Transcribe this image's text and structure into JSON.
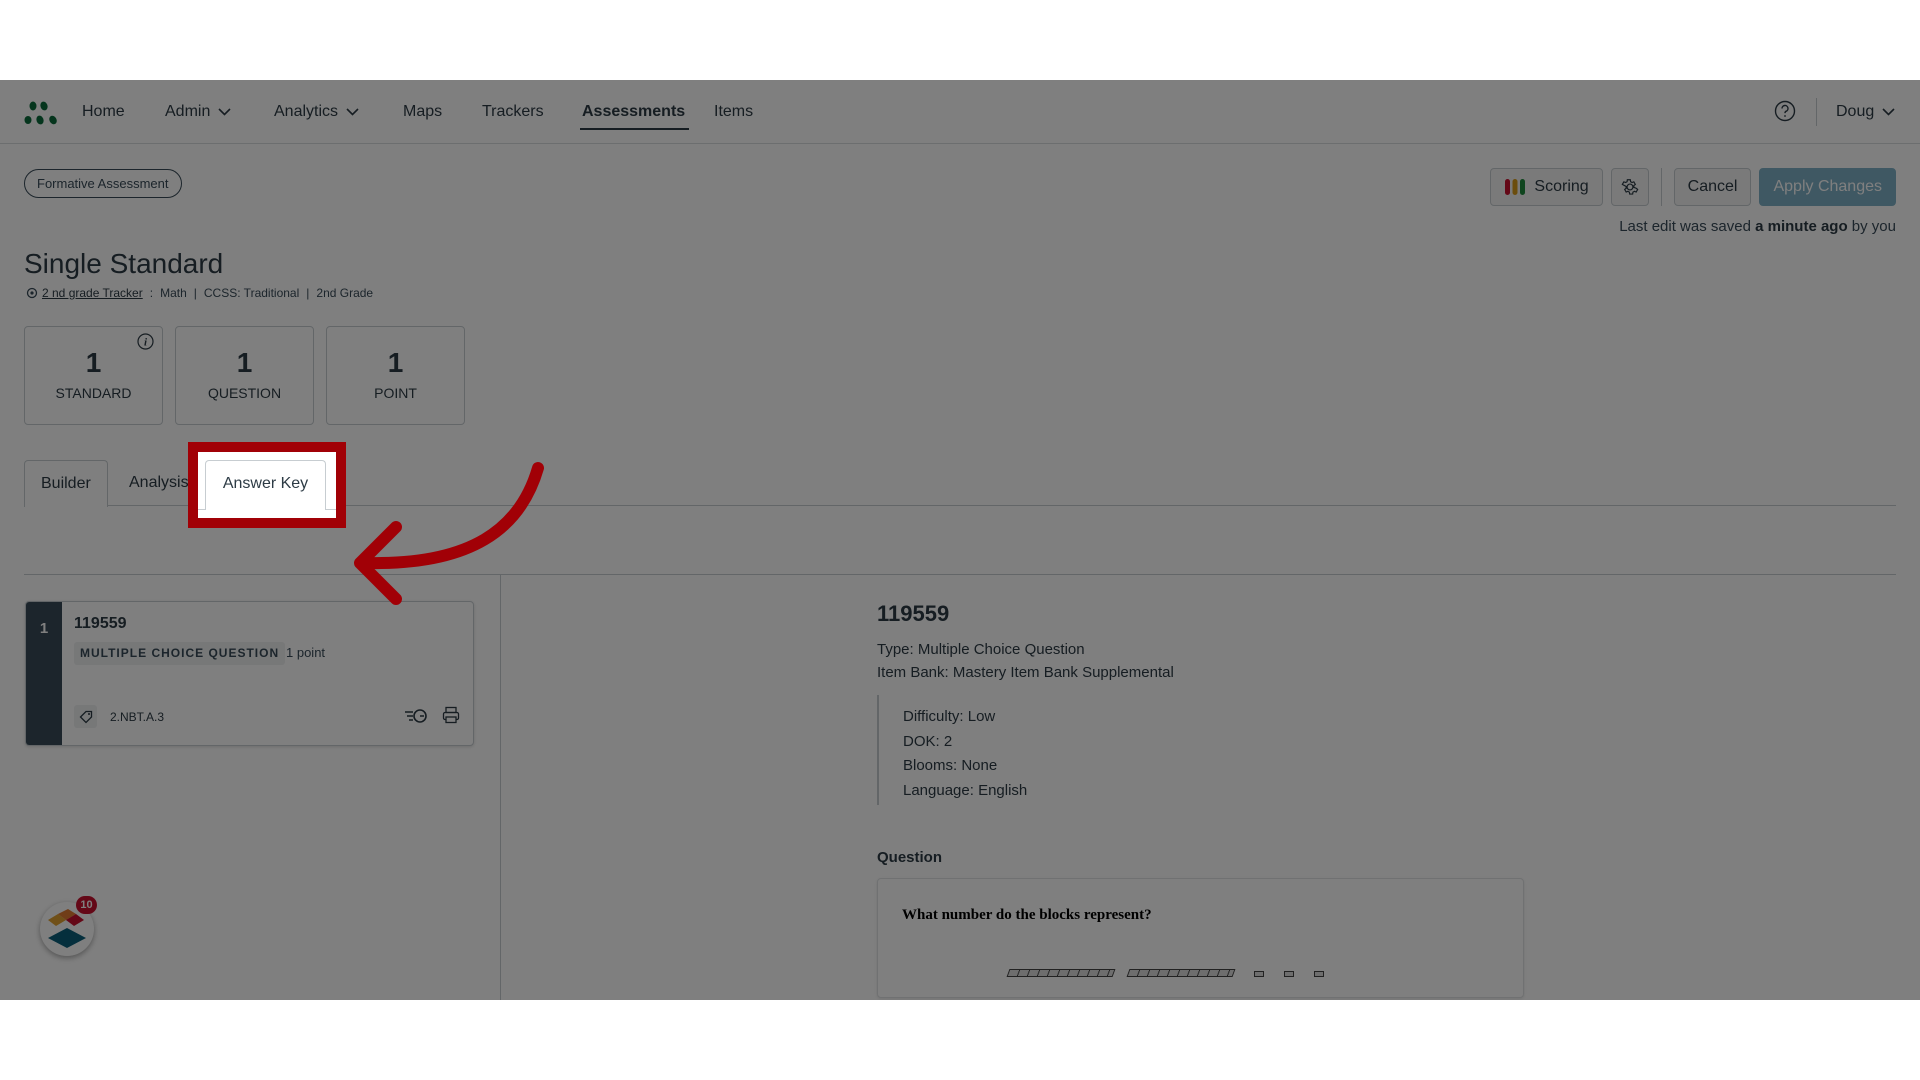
{
  "nav": {
    "items": [
      {
        "label": "Home",
        "has_dropdown": false,
        "active": false
      },
      {
        "label": "Admin",
        "has_dropdown": true,
        "active": false
      },
      {
        "label": "Analytics",
        "has_dropdown": true,
        "active": false
      },
      {
        "label": "Maps",
        "has_dropdown": false,
        "active": false
      },
      {
        "label": "Trackers",
        "has_dropdown": false,
        "active": false
      },
      {
        "label": "Assessments",
        "has_dropdown": false,
        "active": true
      },
      {
        "label": "Items",
        "has_dropdown": false,
        "active": false
      }
    ],
    "help_icon": "question-circle-icon",
    "user": "Doug"
  },
  "header": {
    "badge": "Formative Assessment",
    "title": "Single Standard",
    "meta": {
      "tracker_link": "2 nd grade Tracker",
      "colon": ":",
      "subject": "Math",
      "framework": "CCSS: Traditional",
      "grade": "2nd Grade",
      "divider": "|"
    },
    "toolbar": {
      "scoring_label": "Scoring",
      "cancel_label": "Cancel",
      "apply_label": "Apply Changes"
    },
    "saved": {
      "prefix": "Last edit was saved ",
      "when": "a minute ago",
      "suffix": " by you"
    }
  },
  "stats": [
    {
      "value": "1",
      "label": "STANDARD",
      "has_info": true
    },
    {
      "value": "1",
      "label": "QUESTION",
      "has_info": false
    },
    {
      "value": "1",
      "label": "POINT",
      "has_info": false
    }
  ],
  "tabs": [
    {
      "label": "Builder",
      "selected": true
    },
    {
      "label": "Analysis",
      "selected": false
    },
    {
      "label": "Answer Key",
      "selected": false,
      "highlighted": true
    }
  ],
  "question_list": [
    {
      "index": "1",
      "id": "119559",
      "type": "MULTIPLE CHOICE QUESTION",
      "points": "1 point",
      "standard": "2.NBT.A.3"
    }
  ],
  "detail": {
    "id": "119559",
    "type_line": "Type: Multiple Choice Question",
    "bank_line": "Item Bank: Mastery Item Bank Supplemental",
    "properties": [
      "Difficulty: Low",
      "DOK: 2",
      "Blooms: None",
      "Language: English"
    ],
    "question_heading": "Question",
    "question_text": "What number do the blocks represent?"
  },
  "widget": {
    "notification_count": "10"
  },
  "colors": {
    "highlight_red": "#a10006",
    "logo_green": "#0b6b3a",
    "primary_blue": "#2b7ea1",
    "overlay": "rgba(0,0,0,0.5)"
  }
}
